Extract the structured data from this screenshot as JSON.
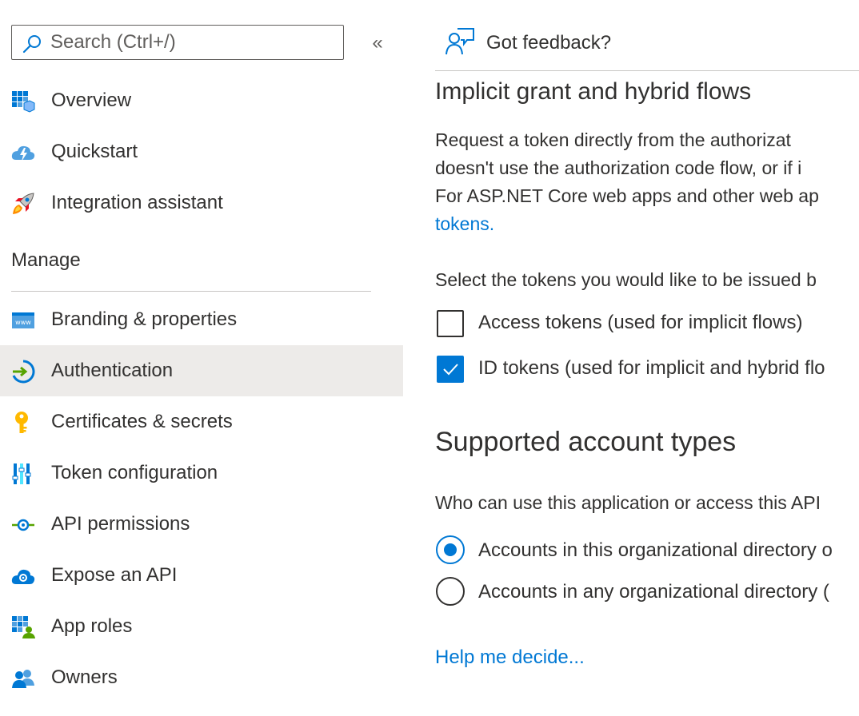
{
  "sidebar": {
    "search_placeholder": "Search (Ctrl+/)",
    "collapse_glyph": "«",
    "items_top": [
      {
        "label": "Overview",
        "icon": "overview-icon"
      },
      {
        "label": "Quickstart",
        "icon": "quickstart-icon"
      },
      {
        "label": "Integration assistant",
        "icon": "rocket-icon"
      }
    ],
    "manage_header": "Manage",
    "items_manage": [
      {
        "label": "Branding & properties",
        "icon": "branding-icon"
      },
      {
        "label": "Authentication",
        "icon": "authentication-icon",
        "selected": true
      },
      {
        "label": "Certificates & secrets",
        "icon": "key-icon"
      },
      {
        "label": "Token configuration",
        "icon": "token-config-icon"
      },
      {
        "label": "API permissions",
        "icon": "api-permissions-icon"
      },
      {
        "label": "Expose an API",
        "icon": "expose-api-icon"
      },
      {
        "label": "App roles",
        "icon": "app-roles-icon"
      },
      {
        "label": "Owners",
        "icon": "owners-icon"
      }
    ]
  },
  "main": {
    "feedback_label": "Got feedback?",
    "implicit": {
      "title": "Implicit grant and hybrid flows",
      "desc_line1": "Request a token directly from the authorizat",
      "desc_line2": "doesn't use the authorization code flow, or if i",
      "desc_line3": "For ASP.NET Core web apps and other web ap",
      "desc_link": "tokens.",
      "select_prompt": "Select the tokens you would like to be issued b",
      "access_tokens_label": "Access tokens (used for implicit flows)",
      "access_tokens_checked": false,
      "id_tokens_label": "ID tokens (used for implicit and hybrid flo",
      "id_tokens_checked": true
    },
    "account_types": {
      "title": "Supported account types",
      "question": "Who can use this application or access this API",
      "option1_label": "Accounts in this organizational directory o",
      "option1_selected": true,
      "option2_label": "Accounts in any organizational directory (",
      "option2_selected": false,
      "help_link": "Help me decide..."
    }
  },
  "colors": {
    "accent": "#0078d4",
    "selected_bg": "#edebe9",
    "text": "#323130",
    "divider": "#c8c6c4"
  }
}
